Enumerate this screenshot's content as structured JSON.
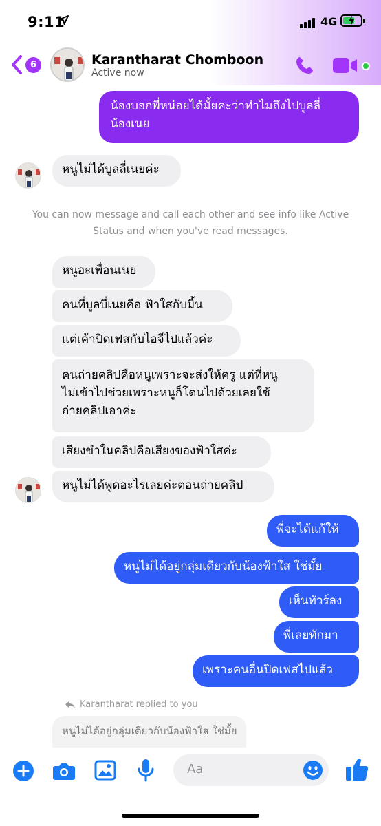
{
  "status_bar": {
    "time": "9:11",
    "network": "4G"
  },
  "header": {
    "back_count": "6",
    "contact_name": "Karantharat Chomboon",
    "contact_status": "Active now"
  },
  "messages": [
    {
      "side": "out",
      "lines": [
        "น้องบอกพี่หน่อยได้มั้ยคะว่าทำไมถึงไปบูลลี่",
        "น้องเนย"
      ]
    },
    {
      "side": "in",
      "lines": [
        "หนูไม่ได้บูลลี่เนยค่ะ"
      ]
    },
    {
      "side": "in",
      "lines": [
        "หนูอะเพื่อนเนย"
      ]
    },
    {
      "side": "in",
      "lines": [
        "คนที่บูลบี่เนยคือ ฟ้าใสกับมิ้น"
      ]
    },
    {
      "side": "in",
      "lines": [
        "แต่เค้าปิดเฟสกับไอจีไปแล้วค่ะ"
      ]
    },
    {
      "side": "in",
      "lines": [
        "คนถ่ายคลิปคือหนูเพราะจะส่งให้ครู แต่ที่หนู",
        "ไม่เข้าไปช่วยเพราะหนูก็โดนไปด้วยเลยใช้",
        "ถ่ายคลิปเอาค่ะ"
      ]
    },
    {
      "side": "in",
      "lines": [
        "เสียงขำในคลิปคือเสียงของฟ้าใสค่ะ"
      ]
    },
    {
      "side": "in",
      "lines": [
        "หนูไม่ได้พูดอะไรเลยค่ะตอนถ่ายคลิป"
      ]
    },
    {
      "side": "out",
      "lines": [
        "พี่จะได้แก้ให้"
      ]
    },
    {
      "side": "out",
      "lines": [
        "หนูไม่ได้อยู่กลุ่มเดียวกับน้องฟ้าใส ใช่มั้ย"
      ]
    },
    {
      "side": "out",
      "lines": [
        "เห็นทัวร์ลง"
      ]
    },
    {
      "side": "out",
      "lines": [
        "พี่เลยทักมา"
      ]
    },
    {
      "side": "out",
      "lines": [
        "เพราะคนอื่นปิดเฟสไปแล้ว"
      ]
    }
  ],
  "system_note": {
    "line1": "You can now message and call each other and see info like Active",
    "line2": "Status and when you've read messages."
  },
  "reply": {
    "label": "Karantharat replied to you",
    "quoted_text": "หนูไม่ได้อยู่กลุ่มเดียวกับน้องฟ้าใส ใช่มั้ย"
  },
  "composer": {
    "placeholder": "Aa"
  },
  "colors": {
    "accent": "#a334fa",
    "purple_bubble": "#8a2cf0",
    "blue_bubble": "#2f5cf7",
    "incoming_bubble": "#efeff1",
    "composer_icon": "#1a7cf5",
    "active_green": "#31cc46"
  },
  "icons": [
    "location-arrow-icon",
    "signal-icon",
    "battery-icon",
    "back-chevron-icon",
    "phone-icon",
    "video-camera-icon",
    "reply-arrow-icon",
    "add-icon",
    "camera-icon",
    "photo-icon",
    "microphone-icon",
    "emoji-icon",
    "thumbs-up-icon"
  ]
}
